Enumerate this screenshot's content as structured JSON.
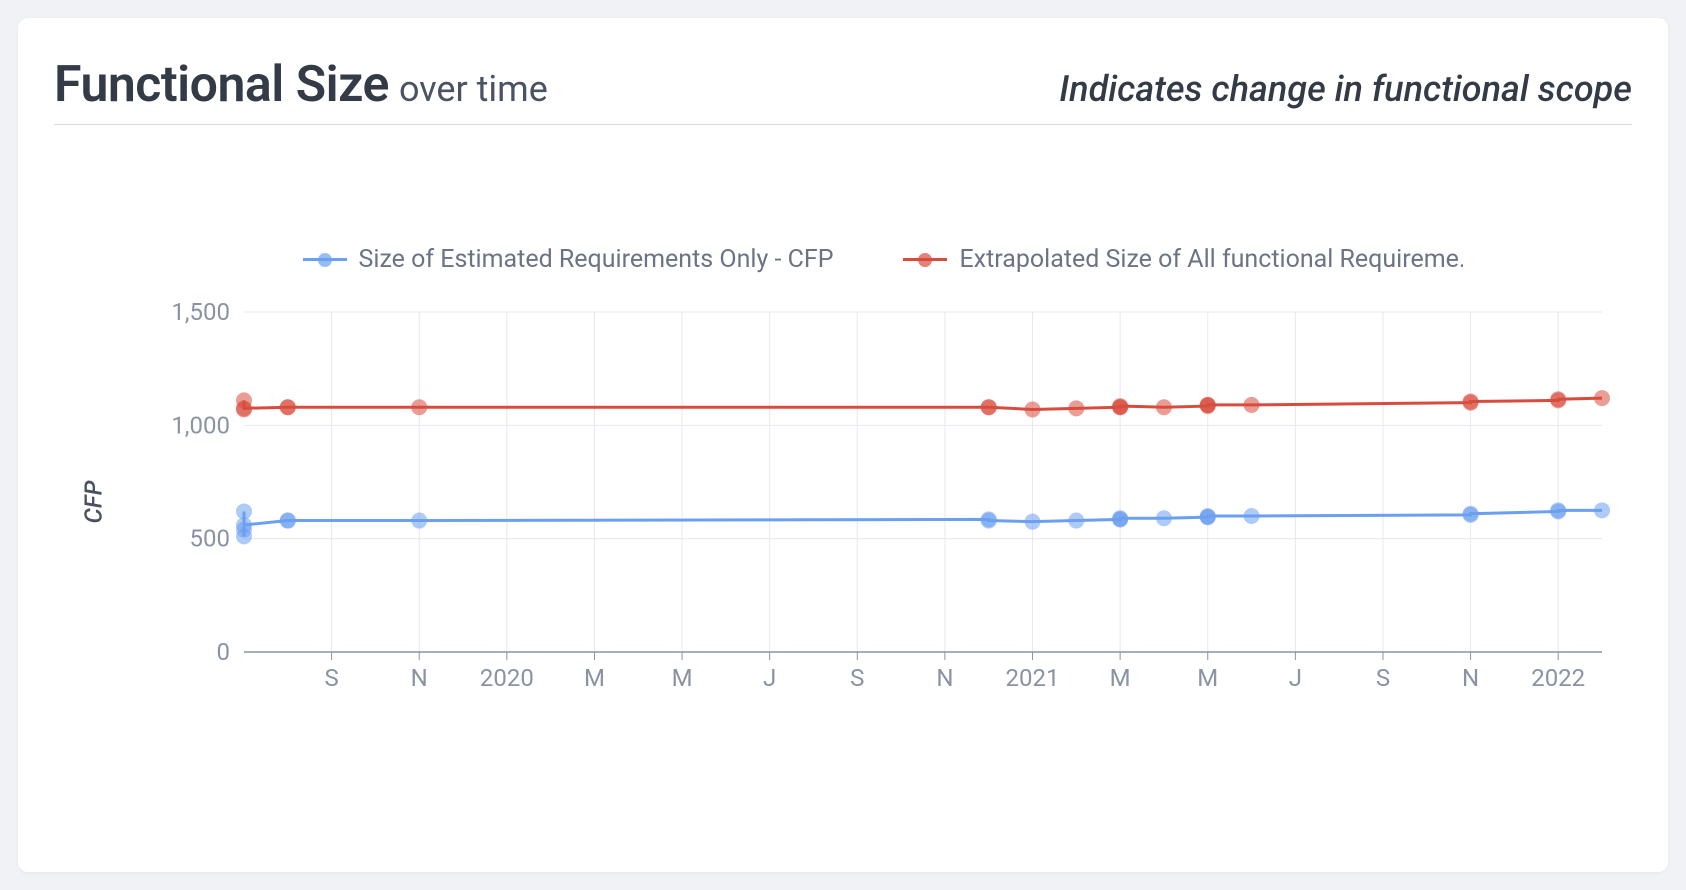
{
  "header": {
    "title_main": "Functional Size",
    "title_sub": "over time",
    "subtitle_right": "Indicates change in functional scope"
  },
  "chart_data": {
    "type": "line",
    "ylabel": "CFP",
    "xlabel": "",
    "ylim": [
      0,
      1500
    ],
    "y_ticks": [
      0,
      500,
      1000,
      1500
    ],
    "x_range_months": [
      "2019-07",
      "2022-02"
    ],
    "x_tick_labels": [
      "S",
      "N",
      "2020",
      "M",
      "M",
      "J",
      "S",
      "N",
      "2021",
      "M",
      "M",
      "J",
      "S",
      "N",
      "2022"
    ],
    "x_tick_months": [
      "2019-09",
      "2019-11",
      "2020-01",
      "2020-03",
      "2020-05",
      "2020-07",
      "2020-09",
      "2020-11",
      "2021-01",
      "2021-03",
      "2021-05",
      "2021-07",
      "2021-09",
      "2021-11",
      "2022-01"
    ],
    "series": [
      {
        "name": "Size of Estimated Requirements Only - CFP",
        "color": "#6b9ff0",
        "points": [
          {
            "m": "2019-07",
            "v": 620
          },
          {
            "m": "2019-07",
            "v": 510
          },
          {
            "m": "2019-07",
            "v": 540
          },
          {
            "m": "2019-07",
            "v": 560
          },
          {
            "m": "2019-08",
            "v": 580
          },
          {
            "m": "2019-08",
            "v": 580
          },
          {
            "m": "2019-11",
            "v": 580
          },
          {
            "m": "2020-12",
            "v": 585
          },
          {
            "m": "2020-12",
            "v": 580
          },
          {
            "m": "2021-01",
            "v": 575
          },
          {
            "m": "2021-02",
            "v": 580
          },
          {
            "m": "2021-03",
            "v": 585
          },
          {
            "m": "2021-03",
            "v": 585
          },
          {
            "m": "2021-03",
            "v": 590
          },
          {
            "m": "2021-04",
            "v": 590
          },
          {
            "m": "2021-05",
            "v": 595
          },
          {
            "m": "2021-05",
            "v": 595
          },
          {
            "m": "2021-05",
            "v": 600
          },
          {
            "m": "2021-06",
            "v": 600
          },
          {
            "m": "2021-11",
            "v": 605
          },
          {
            "m": "2021-11",
            "v": 610
          },
          {
            "m": "2022-01",
            "v": 620
          },
          {
            "m": "2022-01",
            "v": 625
          },
          {
            "m": "2022-02",
            "v": 625
          }
        ]
      },
      {
        "name": "Extrapolated Size of All functional Requireme…",
        "color": "#d84c3e",
        "points": [
          {
            "m": "2019-07",
            "v": 1110
          },
          {
            "m": "2019-07",
            "v": 1070
          },
          {
            "m": "2019-07",
            "v": 1075
          },
          {
            "m": "2019-08",
            "v": 1080
          },
          {
            "m": "2019-08",
            "v": 1080
          },
          {
            "m": "2019-11",
            "v": 1080
          },
          {
            "m": "2020-12",
            "v": 1080
          },
          {
            "m": "2020-12",
            "v": 1080
          },
          {
            "m": "2021-01",
            "v": 1070
          },
          {
            "m": "2021-02",
            "v": 1075
          },
          {
            "m": "2021-03",
            "v": 1080
          },
          {
            "m": "2021-03",
            "v": 1080
          },
          {
            "m": "2021-03",
            "v": 1085
          },
          {
            "m": "2021-04",
            "v": 1080
          },
          {
            "m": "2021-05",
            "v": 1085
          },
          {
            "m": "2021-05",
            "v": 1090
          },
          {
            "m": "2021-05",
            "v": 1090
          },
          {
            "m": "2021-06",
            "v": 1090
          },
          {
            "m": "2021-11",
            "v": 1100
          },
          {
            "m": "2021-11",
            "v": 1105
          },
          {
            "m": "2022-01",
            "v": 1110
          },
          {
            "m": "2022-01",
            "v": 1115
          },
          {
            "m": "2022-02",
            "v": 1120
          }
        ]
      }
    ]
  }
}
